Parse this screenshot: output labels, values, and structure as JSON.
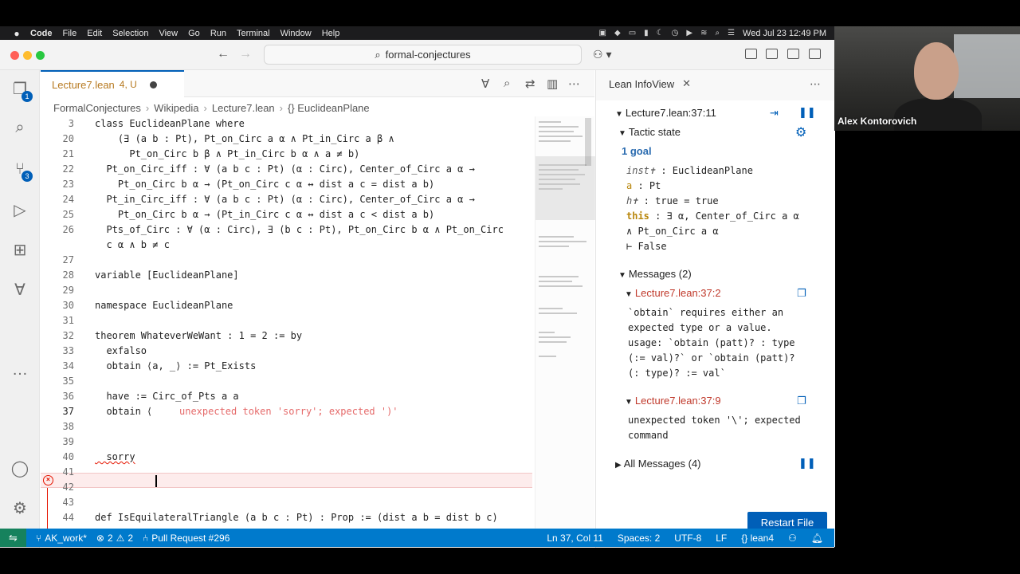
{
  "menubar": {
    "app": "Code",
    "items": [
      "File",
      "Edit",
      "Selection",
      "View",
      "Go",
      "Run",
      "Terminal",
      "Window",
      "Help"
    ],
    "clock": "Wed Jul 23  12:49 PM"
  },
  "titlebar": {
    "search": "formal-conjectures"
  },
  "activity": {
    "explorer_badge": "1",
    "scm_badge": "3"
  },
  "tab": {
    "filename": "Lecture7.lean",
    "status": "4, U"
  },
  "breadcrumb": [
    "FormalConjectures",
    "Wikipedia",
    "Lecture7.lean",
    "{} EuclideanPlane"
  ],
  "code": {
    "lines": [
      {
        "n": "3",
        "t": "class EuclideanPlane where"
      },
      {
        "n": "20",
        "t": "    (∃ (a b : Pt), Pt_on_Circ a α ∧ Pt_in_Circ a β ∧"
      },
      {
        "n": "21",
        "t": "      Pt_on_Circ b β ∧ Pt_in_Circ b α ∧ a ≠ b)"
      },
      {
        "n": "22",
        "t": "  Pt_on_Circ_iff : ∀ (a b c : Pt) (α : Circ), Center_of_Circ a α →"
      },
      {
        "n": "23",
        "t": "    Pt_on_Circ b α → (Pt_on_Circ c α ↔ dist a c = dist a b)"
      },
      {
        "n": "24",
        "t": "  Pt_in_Circ_iff : ∀ (a b c : Pt) (α : Circ), Center_of_Circ a α →"
      },
      {
        "n": "25",
        "t": "    Pt_on_Circ b α → (Pt_in_Circ c α ↔ dist a c < dist a b)"
      },
      {
        "n": "26",
        "t": "  Pts_of_Circ : ∀ (α : Circ), ∃ (b c : Pt), Pt_on_Circ b α ∧ Pt_on_Circ"
      },
      {
        "n": "",
        "t": "  c α ∧ b ≠ c"
      },
      {
        "n": "27",
        "t": ""
      },
      {
        "n": "28",
        "t": "variable [EuclideanPlane]"
      },
      {
        "n": "29",
        "t": ""
      },
      {
        "n": "30",
        "t": "namespace EuclideanPlane"
      },
      {
        "n": "31",
        "t": ""
      },
      {
        "n": "32",
        "t": "theorem WhateverWeWant : 1 = 2 := by"
      },
      {
        "n": "33",
        "t": "  exfalso"
      },
      {
        "n": "34",
        "t": "  obtain ⟨a, _⟩ := Pt_Exists"
      },
      {
        "n": "35",
        "t": ""
      },
      {
        "n": "36",
        "t": "  have := Circ_of_Pts a a"
      },
      {
        "n": "37",
        "t": "  obtain ⟨"
      },
      {
        "n": "38",
        "t": ""
      },
      {
        "n": "39",
        "t": ""
      },
      {
        "n": "40",
        "t": "  sorry"
      },
      {
        "n": "41",
        "t": ""
      },
      {
        "n": "42",
        "t": ""
      },
      {
        "n": "43",
        "t": ""
      },
      {
        "n": "44",
        "t": "def IsEquilateralTriangle (a b c : Pt) : Prop := (dist a b = dist b c)"
      }
    ],
    "inline_error": "unexpected token 'sorry'; expected ')'"
  },
  "infoview": {
    "title": "Lean InfoView",
    "location": "Lecture7.lean:37:11",
    "tactic_state": "Tactic state",
    "goals": "1 goal",
    "hyps": [
      {
        "name": "inst✝",
        "type": " : EuclideanPlane"
      },
      {
        "name": "a",
        "type": " : Pt"
      },
      {
        "name": "h✝",
        "type": " : true = true"
      },
      {
        "name": "this",
        "type": " : ∃ α, Center_of_Circ a α"
      }
    ],
    "hyp_cont": "∧ Pt_on_Circ a α",
    "goal": "⊢ False",
    "messages_header": "Messages (2)",
    "msg1_loc": "Lecture7.lean:37:2",
    "msg1": "`obtain` requires either an\nexpected type or a value.\nusage: `obtain (patt)? : type\n(:= val)?` or `obtain (patt)?\n(: type)? := val`",
    "msg2_loc": "Lecture7.lean:37:9",
    "msg2": "unexpected token '\\'; expected\ncommand",
    "all_messages": "All Messages (4)",
    "restart": "Restart File"
  },
  "statusbar": {
    "branch": "AK_work*",
    "errors": "2",
    "warnings": "2",
    "pr": "Pull Request #296",
    "position": "Ln 37, Col 11",
    "spaces": "Spaces: 2",
    "encoding": "UTF-8",
    "eol": "LF",
    "language": "lean4"
  },
  "webcam": {
    "name": "Alex Kontorovich"
  }
}
